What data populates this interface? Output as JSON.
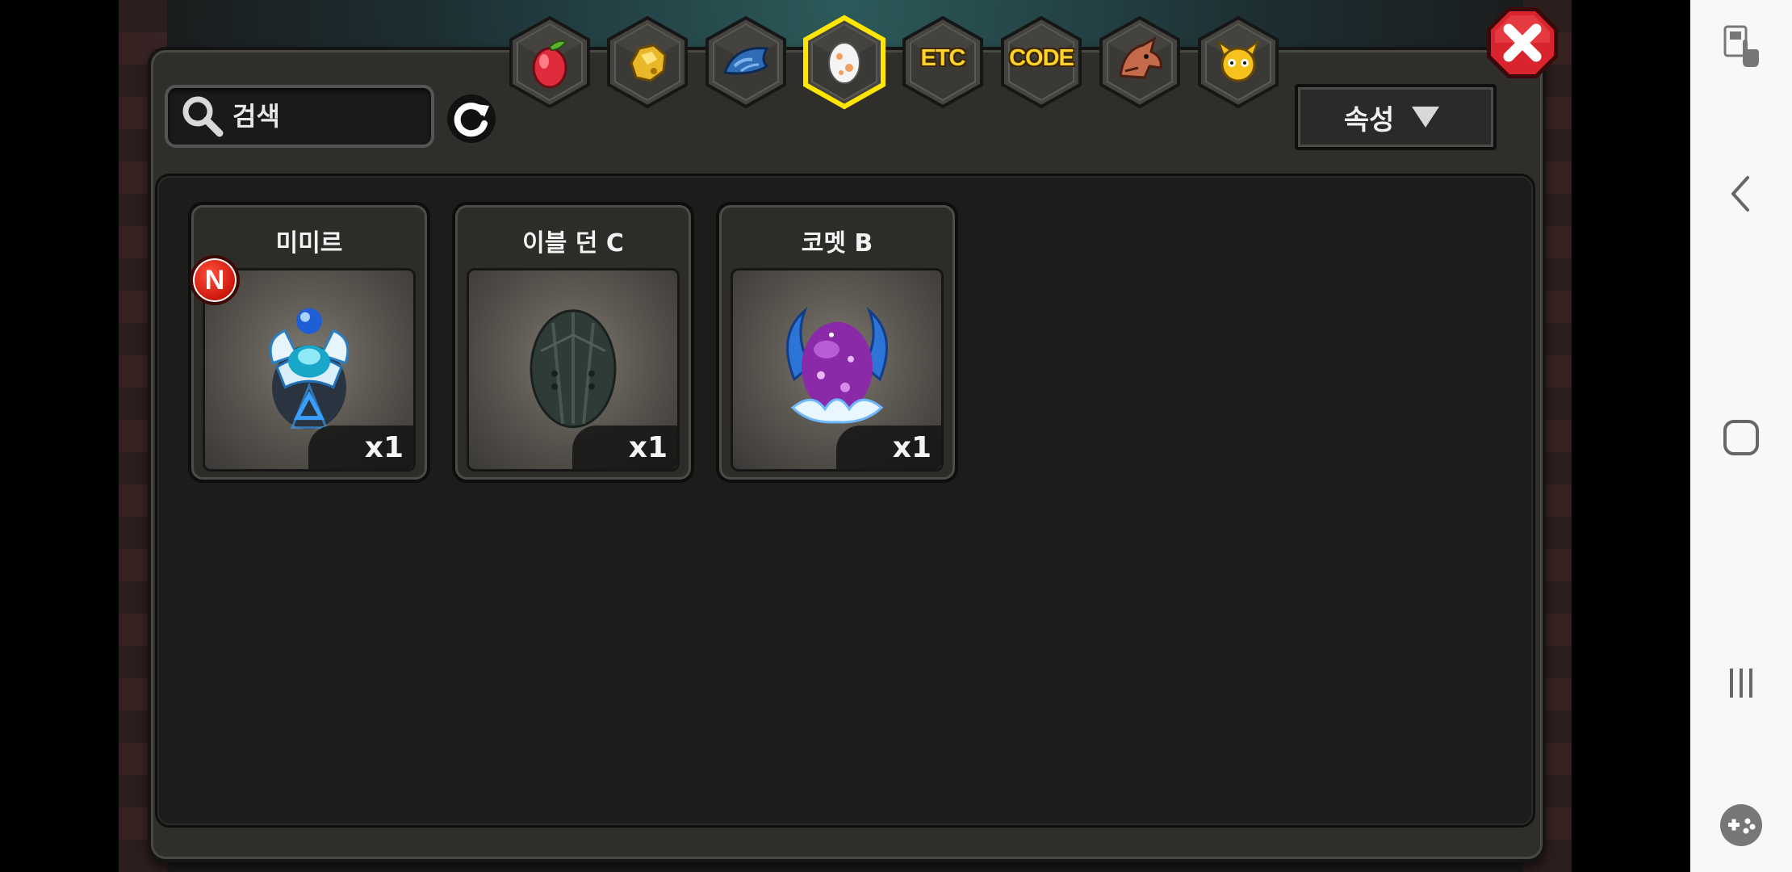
{
  "tabs": [
    {
      "name": "tab-fruit",
      "icon": "red-fruit-icon",
      "label": ""
    },
    {
      "name": "tab-gold",
      "icon": "gold-nugget-icon",
      "label": ""
    },
    {
      "name": "tab-dragon-scale",
      "icon": "blue-scale-icon",
      "label": ""
    },
    {
      "name": "tab-egg",
      "icon": "egg-icon",
      "label": "",
      "selected": true
    },
    {
      "name": "tab-etc",
      "icon": "",
      "label": "ETC"
    },
    {
      "name": "tab-code",
      "icon": "",
      "label": "CODE"
    },
    {
      "name": "tab-dragon",
      "icon": "dragon-head-icon",
      "label": ""
    },
    {
      "name": "tab-character",
      "icon": "yellow-creature-icon",
      "label": ""
    }
  ],
  "search": {
    "placeholder": "검색"
  },
  "sort": {
    "label": "속성"
  },
  "items": [
    {
      "name": "미미르",
      "quantity": "x1",
      "is_new": true,
      "badge": "N",
      "icon": "blue-white-armored-egg-icon"
    },
    {
      "name": "이블 던 C",
      "quantity": "x1",
      "is_new": false,
      "icon": "dark-green-egg-icon"
    },
    {
      "name": "코멧 B",
      "quantity": "x1",
      "is_new": false,
      "icon": "purple-horned-egg-icon"
    }
  ],
  "colors": {
    "selected_tab_border": "#ffe600",
    "tab_label": "#ffd22a",
    "close_button": "#d9232d",
    "panel": "#2f2e2b",
    "inner_panel": "#1c1c1b"
  }
}
